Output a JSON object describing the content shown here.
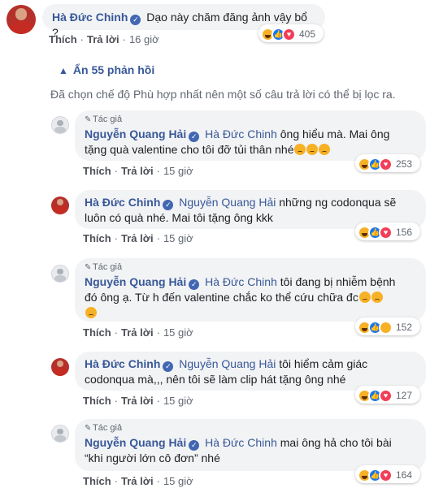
{
  "actions": {
    "like": "Thích",
    "reply": "Trả lời",
    "dot": "·"
  },
  "top_comment": {
    "author": "Hà Đức Chinh",
    "text": "Dạo này chăm đăng ảnh vậy bổ ?",
    "time": "16 giờ",
    "reactions": [
      "haha",
      "like",
      "love"
    ],
    "reaction_count": "405"
  },
  "hide_replies": "Ẩn 55 phản hồi",
  "filter_notice": "Đã chọn chế độ Phù hợp nhất nên một số câu trả lời có thể bị lọc ra.",
  "author_badge": "Tác giả",
  "replies": [
    {
      "author": "Nguyễn Quang Hải",
      "is_author": true,
      "mention": "Hà Đức Chinh",
      "text1": "ông hiểu mà. Mai ông",
      "text2": "tặng quà valentine cho tôi đỡ tủi thân nhé",
      "emoji_after": 3,
      "time": "15 giờ",
      "reactions": [
        "haha",
        "like",
        "love"
      ],
      "reaction_count": "253"
    },
    {
      "author": "Hà Đức Chinh",
      "is_author": false,
      "mention": "Nguyễn Quang Hải",
      "text1": "những ng codonqua sẽ",
      "text2": "luôn có quà nhé. Mai tôi tặng ông kkk",
      "time": "15 giờ",
      "reactions": [
        "haha",
        "like",
        "love"
      ],
      "reaction_count": "156"
    },
    {
      "author": "Nguyễn Quang Hải",
      "is_author": true,
      "mention": "Hà Đức Chinh",
      "text1": "tôi đang bị nhiễm bệnh",
      "text2": "đó ông ạ. Từ h đến valentine chắc ko thể cứu chữa đc",
      "time": "15 giờ",
      "reactions": [
        "haha",
        "like",
        "sad"
      ],
      "reaction_count": "152"
    },
    {
      "author": "Hà Đức Chinh",
      "is_author": false,
      "mention": "Nguyễn Quang Hải",
      "text1": "tôi hiểm cảm giác",
      "text2": "codonqua mà,,, nên tôi sẽ làm clip hát tặng ông nhé",
      "time": "15 giờ",
      "reactions": [
        "haha",
        "like",
        "love"
      ],
      "reaction_count": "127"
    },
    {
      "author": "Nguyễn Quang Hải",
      "is_author": true,
      "mention": "Hà Đức Chinh",
      "text1": "mai ông hả cho tôi bài",
      "text2": "“khi người lớn cô đơn” nhé",
      "time": "15 giờ",
      "reactions": [
        "haha",
        "like",
        "love"
      ],
      "reaction_count": "164"
    }
  ]
}
